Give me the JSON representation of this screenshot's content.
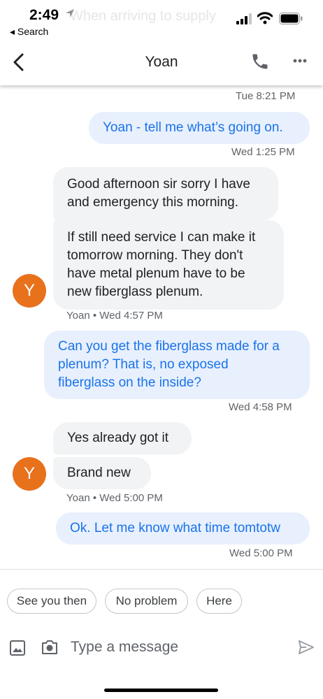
{
  "status_bar": {
    "time": "2:49",
    "back_label": "◂ Search",
    "ghost_text": "When arriving to supply"
  },
  "header": {
    "title": "Yoan",
    "back_icon": "chevron-left-icon",
    "call_icon": "phone-icon",
    "more_icon": "more-horiz-icon"
  },
  "conversation": {
    "ts_tue": "Tue 8:21 PM",
    "msg1": "Yoan - tell me what’s going on.",
    "ts1": "Wed 1:25 PM",
    "msg2_line1": "Good afternoon sir sorry I have",
    "msg2_line2": "and emergency this morning.",
    "msg3_line1": "If still need service I can make it",
    "msg3_line2": "tomorrow morning. They don't",
    "msg3_line3": "have metal plenum have to be",
    "msg3_line4": "new fiberglass plenum.",
    "avatar_letter": "Y",
    "meta1": "Yoan • Wed 4:57 PM",
    "msg4_line1": "Can you get the fiberglass made for a",
    "msg4_line2": "plenum? That is, no exposed",
    "msg4_line3": "fiberglass on the inside?",
    "ts2": "Wed 4:58 PM",
    "msg5": "Yes already got it",
    "msg6": "Brand new",
    "meta2": "Yoan • Wed 5:00 PM",
    "msg7": "Ok. Let me know what time tomtotw",
    "ts3": "Wed 5:00 PM"
  },
  "suggestions": [
    "See you then",
    "No problem",
    "Here"
  ],
  "compose": {
    "placeholder": "Type a message",
    "image_icon": "image-icon",
    "camera_icon": "camera-icon",
    "send_icon": "send-icon"
  },
  "colors": {
    "outgoing_bubble": "#e8f0fe",
    "outgoing_text": "#1a73e8",
    "incoming_bubble": "#f1f3f4",
    "avatar": "#e8711c"
  }
}
